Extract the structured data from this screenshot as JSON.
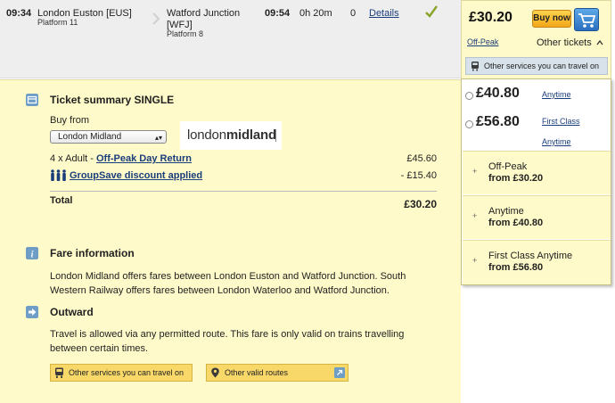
{
  "journey": {
    "departure_time": "09:34",
    "departure_station": "London Euston [EUS]",
    "departure_platform": "Platform 11",
    "arrival_station": "Watford Junction [WFJ]",
    "arrival_platform": "Platform 8",
    "arrival_time": "09:54",
    "duration": "0h 20m",
    "changes": "0",
    "details_label": "Details"
  },
  "price_panel": {
    "price": "£30.20",
    "buy_label": "Buy now",
    "fare_type": "Off-Peak",
    "other_tickets_label": "Other tickets",
    "services_label": "Other services you can travel on"
  },
  "other_tickets": {
    "options": [
      {
        "price": "£40.80",
        "type": "Anytime"
      },
      {
        "price": "£56.80",
        "type_line1": "First Class",
        "type_line2": "Anytime"
      }
    ],
    "families": [
      {
        "name": "Off-Peak",
        "from": "from £30.20"
      },
      {
        "name": "Anytime",
        "from": "from £40.80"
      },
      {
        "name": "First Class Anytime",
        "from": "from £56.80"
      }
    ]
  },
  "summary": {
    "title": "Ticket summary SINGLE",
    "buy_from_label": "Buy from",
    "retailer": "London Midland",
    "logo_light": "london",
    "logo_bold": "midland",
    "fare_line_prefix": "4 x Adult - ",
    "fare_link": "Off-Peak Day Return",
    "fare_amount": "£45.60",
    "discount_label": "GroupSave discount applied",
    "discount_amount": "- £15.40",
    "total_label": "Total",
    "total_amount": "£30.20"
  },
  "fare_info": {
    "title": "Fare information",
    "text": "London Midland offers fares between London Euston and Watford Junction. South Western Railway offers fares between London Waterloo and Watford Junction."
  },
  "outward": {
    "title": "Outward",
    "text": "Travel is allowed via any permitted route. This fare is only valid on trains travelling between certain times.",
    "services_button": "Other services you can travel on",
    "routes_button": "Other valid routes"
  },
  "colors": {
    "panel_bg": "#fffac9",
    "header_bg": "#eeeeee",
    "link": "#1a3d7c",
    "buy_button": "#f3a71a",
    "cart_button": "#2a6fbf"
  }
}
